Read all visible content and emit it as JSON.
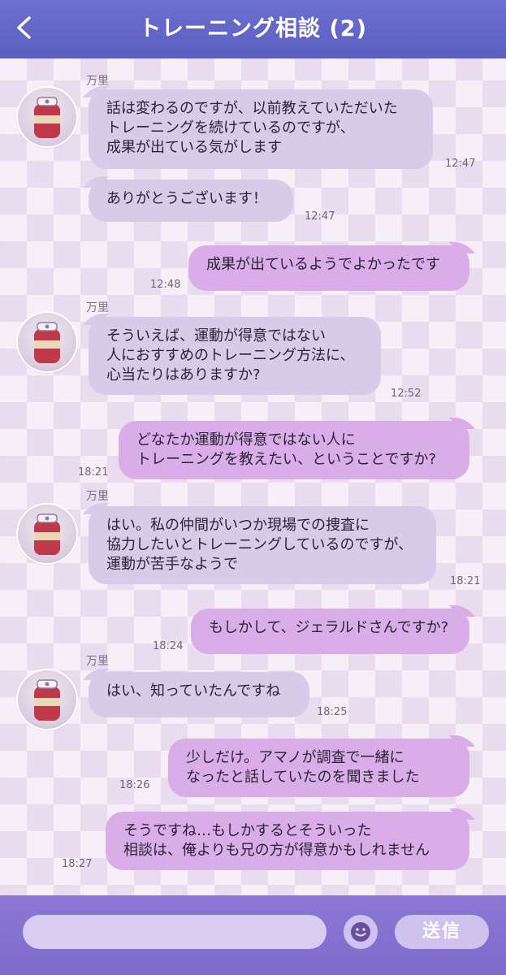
{
  "header": {
    "title": "トレーニング相談 (2)"
  },
  "colors": {
    "header": "#5a5fbf",
    "bubble_in": "#d6cce9",
    "bubble_out": "#d9aee8",
    "footer": "#7e6ccb"
  },
  "icons": {
    "back": "chevron-left-icon",
    "avatar": "pepper-jar-icon",
    "emoji": "smiley-icon"
  },
  "messages": [
    {
      "sender": "万里",
      "text": "話は変わるのですが、以前教えていただいた\nトレーニングを続けているのですが、\n成果が出ている気がします",
      "time": "12:47"
    },
    {
      "sender": "",
      "text": "ありがとうございます！",
      "time": "12:47"
    },
    {
      "sender": "",
      "text": "成果が出ているようでよかったです",
      "time": "12:48"
    },
    {
      "sender": "万里",
      "text": "そういえば、運動が得意ではない\n人におすすめのトレーニング方法に、\n心当たりはありますか?",
      "time": "12:52"
    },
    {
      "sender": "",
      "text": "どなたか運動が得意ではない人に\nトレーニングを教えたい、ということですか?",
      "time": "18:21"
    },
    {
      "sender": "万里",
      "text": "はい。私の仲間がいつか現場での捜査に\n協力したいとトレーニングしているのですが、\n運動が苦手なようで",
      "time": "18:21"
    },
    {
      "sender": "",
      "text": "もしかして、ジェラルドさんですか?",
      "time": "18:24"
    },
    {
      "sender": "万里",
      "text": "はい、知っていたんですね",
      "time": "18:25"
    },
    {
      "sender": "",
      "text": "少しだけ。アマノが調査で一緒に\nなったと話していたのを聞きました",
      "time": "18:26"
    },
    {
      "sender": "",
      "text": "そうですね…もしかするとそういった\n相談は、俺よりも兄の方が得意かもしれません",
      "time": "18:27"
    }
  ],
  "footer": {
    "input_placeholder": "",
    "send_label": "送信"
  }
}
